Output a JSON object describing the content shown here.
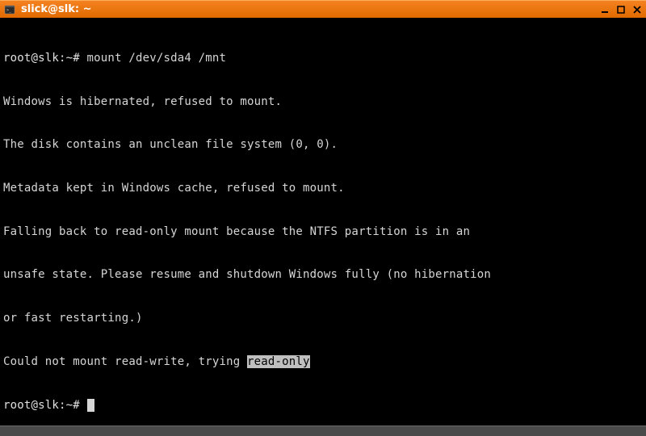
{
  "titlebar": {
    "title": "slick@slk: ~",
    "icon": "terminal-icon",
    "minimize": "_",
    "maximize": "□",
    "close": "×"
  },
  "terminal": {
    "prompt1_user": "root@slk",
    "prompt1_path": ":~#",
    "command1": " mount /dev/sda4 /mnt",
    "out1": "Windows is hibernated, refused to mount.",
    "out2": "The disk contains an unclean file system (0, 0).",
    "out3": "Metadata kept in Windows cache, refused to mount.",
    "out4": "Falling back to read-only mount because the NTFS partition is in an",
    "out5": "unsafe state. Please resume and shutdown Windows fully (no hibernation",
    "out6": "or fast restarting.)",
    "out7_pre": "Could not mount read-write, trying ",
    "out7_hl": "read-only",
    "prompt2_user": "root@slk",
    "prompt2_path": ":~#",
    "prompt2_after": " "
  }
}
